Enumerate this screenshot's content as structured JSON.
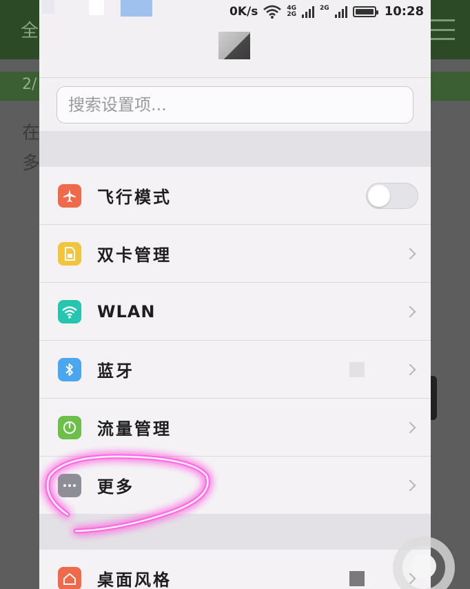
{
  "background_app": {
    "header_char": "全",
    "strip_text": "2/",
    "line1_char": "在",
    "line2_char": "多"
  },
  "status_bar": {
    "net_speed": "0K/s",
    "sim1_label_top": "4G",
    "sim1_label_bottom": "2G",
    "sim2_label": "2G",
    "time": "10:28"
  },
  "search": {
    "placeholder": "搜索设置项..."
  },
  "settings": [
    {
      "label": "飞行模式",
      "icon": "airplane-icon",
      "color": "#ee6a4a",
      "control": "toggle",
      "toggle_on": false
    },
    {
      "label": "双卡管理",
      "icon": "sim-card-icon",
      "color": "#f3c43e",
      "control": "chevron"
    },
    {
      "label": "WLAN",
      "icon": "wifi-icon",
      "color": "#25c5b0",
      "control": "chevron"
    },
    {
      "label": "蓝牙",
      "icon": "bluetooth-icon",
      "color": "#4aa6ee",
      "control": "chevron"
    },
    {
      "label": "流量管理",
      "icon": "data-usage-icon",
      "color": "#6cc04a",
      "control": "chevron"
    },
    {
      "label": "更多",
      "icon": "more-dots-icon",
      "color": "#8e8e96",
      "control": "chevron"
    }
  ],
  "settings_2": [
    {
      "label": "桌面风格",
      "icon": "home-icon",
      "color": "#ee6a4a",
      "control": "chevron"
    }
  ],
  "colors": {
    "highlight": "#ff4fd8",
    "header_green": "#2b4a25"
  }
}
